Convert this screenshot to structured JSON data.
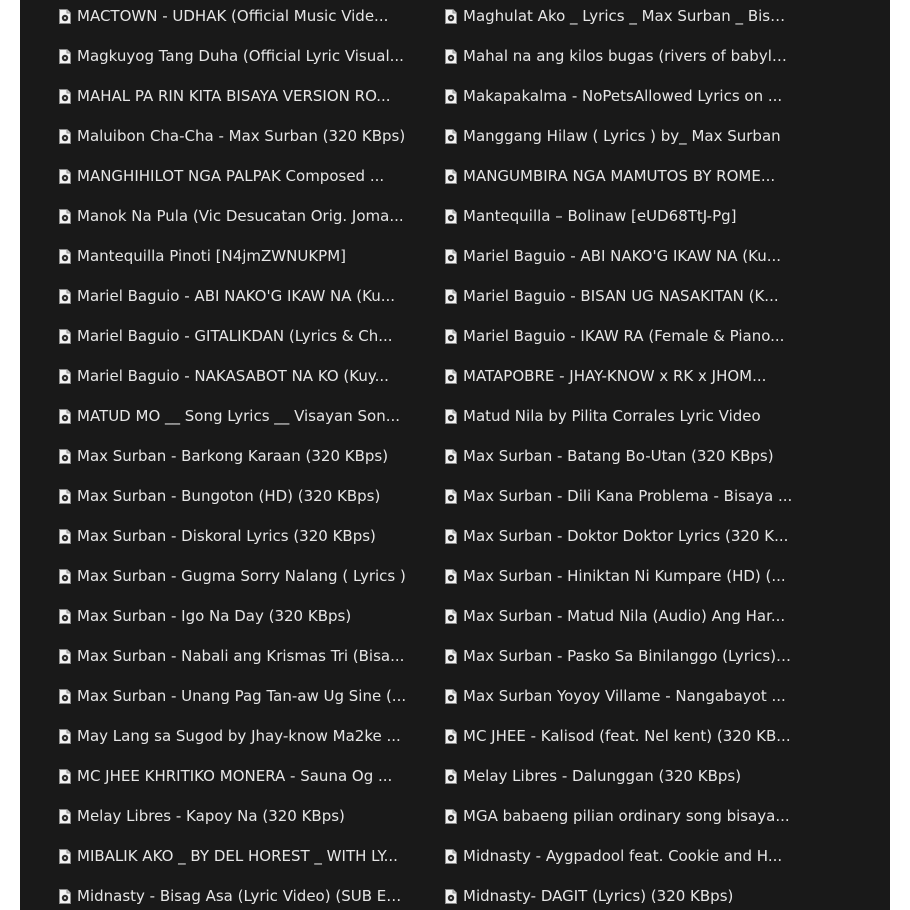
{
  "files": {
    "left": [
      "MACTOWN - UDHAK (Official Music Vide...",
      "Magkuyog Tang Duha (Official Lyric Visual...",
      "MAHAL PA RIN KITA BISAYA VERSION RO...",
      "Maluibon Cha-Cha - Max Surban (320 KBps)",
      "MANGHIHILOT NGA PALPAK Composed ...",
      "Manok Na Pula (Vic Desucatan Orig. Joma...",
      "Mantequilla Pinoti [N4jmZWNUKPM]",
      "Mariel Baguio - ABI NAKO'G IKAW NA (Ku...",
      "Mariel Baguio - GITALIKDAN (Lyrics & Ch...",
      "Mariel Baguio - NAKASABOT NA KO (Kuy...",
      "MATUD MO __ Song Lyrics __ Visayan Son...",
      "Max Surban - Barkong Karaan (320 KBps)",
      "Max Surban - Bungoton (HD) (320 KBps)",
      "Max Surban - Diskoral Lyrics (320 KBps)",
      "Max Surban - Gugma Sorry Nalang ( Lyrics )",
      "Max Surban - Igo Na Day (320 KBps)",
      "Max Surban - Nabali ang Krismas Tri (Bisa...",
      "Max Surban - Unang Pag Tan-aw Ug Sine (...",
      "May Lang sa Sugod by Jhay-know Ma2ke ...",
      "MC JHEE KHRITIKO MONERA - Sauna Og ...",
      "Melay Libres - Kapoy Na (320 KBps)",
      "MIBALIK AKO _ BY DEL HOREST _ WITH LY...",
      "Midnasty - Bisag Asa (Lyric Video) (SUB En..."
    ],
    "right": [
      "Maghulat Ako _ Lyrics _ Max Surban _ Bisa...",
      "Mahal na ang kilos bugas (rivers of babylo...",
      "Makapakalma - NoPetsAllowed Lyrics on ...",
      "Manggang Hilaw ( Lyrics ) by_ Max Surban",
      "MANGUMBIRA NGA MAMUTOS BY ROME...",
      "Mantequilla – Bolinaw [eUD68TtJ-Pg]",
      "Mariel Baguio - ABI NAKO'G IKAW NA (Ku...",
      "Mariel Baguio - BISAN UG NASAKITAN (K...",
      "Mariel Baguio - IKAW RA (Female & Piano...",
      "MATAPOBRE - JHAY-KNOW x RK x JHOM...",
      "Matud Nila by Pilita Corrales Lyric Video",
      "Max Surban - Batang Bo-Utan (320 KBps)",
      "Max Surban - Dili Kana Problema - Bisaya ...",
      "Max Surban - Doktor Doktor Lyrics (320 K...",
      "Max Surban - Hiniktan Ni Kumpare (HD) (...",
      "Max Surban - Matud Nila (Audio) Ang Har...",
      "Max Surban - Pasko Sa Binilanggo (Lyrics) ...",
      "Max Surban Yoyoy Villame - Nangabayot ...",
      "MC JHEE - Kalisod (feat. Nel kent) (320 KB...",
      "Melay Libres - Dalunggan (320 KBps)",
      "MGA babaeng pilian ordinary song bisaya...",
      "Midnasty - Aygpadool feat. Cookie and H...",
      "Midnasty- DAGIT (Lyrics) (320 KBps)"
    ]
  },
  "icons": {
    "file": "audio-file-icon"
  },
  "colors": {
    "background": "#191919",
    "text": "#e6e6e6",
    "icon_page": "#f2f2f2",
    "icon_disc": "#2b2b2b"
  }
}
